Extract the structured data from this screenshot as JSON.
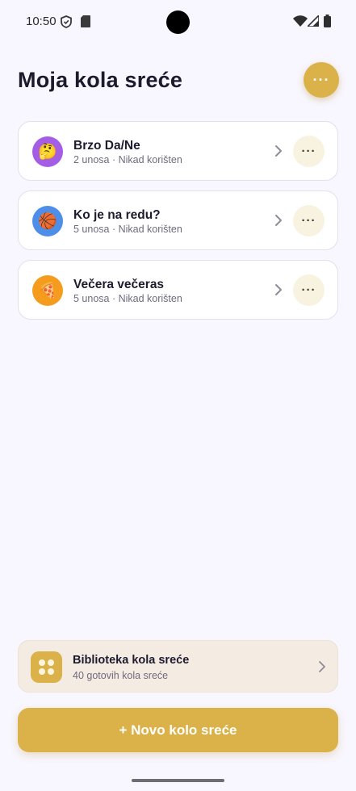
{
  "status_bar": {
    "time": "10:50",
    "left_icons": [
      "shield-icon",
      "sd-card-icon"
    ],
    "right_icons": [
      "wifi-icon",
      "signal-icon",
      "battery-icon"
    ]
  },
  "header": {
    "title": "Moja kola sreće",
    "more_label": "···"
  },
  "wheels": [
    {
      "title": "Brzo Da/Ne",
      "meta": "2 unosa · Nikad korišten",
      "emoji": "🤔",
      "avatar_color": "#a45ee5",
      "more_label": "···"
    },
    {
      "title": "Ko je na redu?",
      "meta": "5 unosa · Nikad korišten",
      "emoji": "🏀",
      "avatar_color": "#4c8ee8",
      "more_label": "···"
    },
    {
      "title": "Večera večeras",
      "meta": "5 unosa · Nikad korišten",
      "emoji": "🍕",
      "avatar_color": "#f59c1f",
      "more_label": "···"
    }
  ],
  "library": {
    "title": "Biblioteka kola sreće",
    "subtitle": "40 gotovih kola sreće"
  },
  "new_button": {
    "label": "+ Novo kolo sreće"
  },
  "colors": {
    "accent": "#dbb24a",
    "background": "#f8f6fe"
  }
}
